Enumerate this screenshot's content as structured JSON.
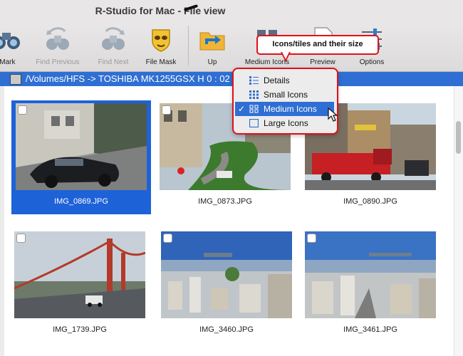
{
  "window": {
    "title": "R-Studio for Mac - File view"
  },
  "toolbar": {
    "find_mark": "/Mark",
    "find_previous": "Find Previous",
    "find_next": "Find Next",
    "file_mask": "File Mask",
    "up": "Up",
    "medium_icons": "Medium Icons",
    "preview": "Preview",
    "options": "Options"
  },
  "callout": {
    "text": "Icons/tiles and their size"
  },
  "path": {
    "text": "/Volumes/HFS -> TOSHIBA MK1255GSX H 0 : 02"
  },
  "view_menu": {
    "items": [
      {
        "label": "Details",
        "checked": false
      },
      {
        "label": "Small Icons",
        "checked": false
      },
      {
        "label": "Medium Icons",
        "checked": true,
        "check_mark": "✓"
      },
      {
        "label": "Large Icons",
        "checked": false
      }
    ]
  },
  "files": [
    {
      "name": "IMG_0869.JPG",
      "selected": true
    },
    {
      "name": "IMG_0873.JPG",
      "selected": false
    },
    {
      "name": "IMG_0890.JPG",
      "selected": false
    },
    {
      "name": "IMG_1739.JPG",
      "selected": false
    },
    {
      "name": "IMG_3460.JPG",
      "selected": false
    },
    {
      "name": "IMG_3461.JPG",
      "selected": false
    }
  ],
  "colors": {
    "accent": "#2f6fd3",
    "selection": "#1e62d8",
    "annotation": "#e0101a"
  }
}
